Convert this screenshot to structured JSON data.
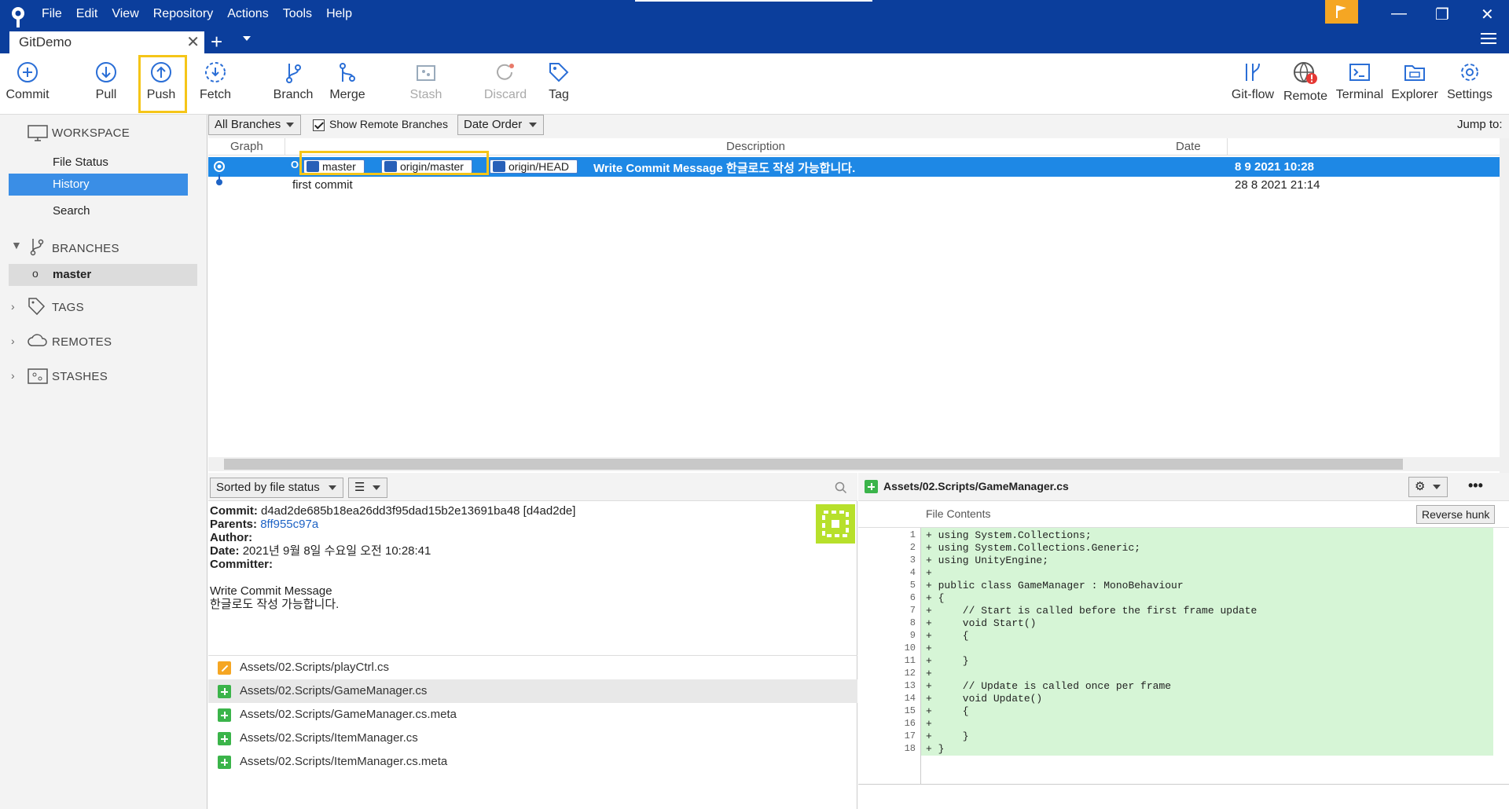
{
  "app": {
    "tab_title": "GitDemo"
  },
  "menu": [
    "File",
    "Edit",
    "View",
    "Repository",
    "Actions",
    "Tools",
    "Help"
  ],
  "toolbar": {
    "commit": "Commit",
    "pull": "Pull",
    "push": "Push",
    "fetch": "Fetch",
    "branch": "Branch",
    "merge": "Merge",
    "stash": "Stash",
    "discard": "Discard",
    "tag": "Tag",
    "gitflow": "Git-flow",
    "remote": "Remote",
    "terminal": "Terminal",
    "explorer": "Explorer",
    "settings": "Settings"
  },
  "sidebar": {
    "workspace": "WORKSPACE",
    "file_status": "File Status",
    "history": "History",
    "search": "Search",
    "branches": "BRANCHES",
    "master": "master",
    "tags": "TAGS",
    "remotes": "REMOTES",
    "stashes": "STASHES"
  },
  "filters": {
    "all_branches": "All Branches",
    "show_remote": "Show Remote Branches",
    "date_order": "Date Order",
    "jump_to": "Jump to:"
  },
  "columns": {
    "graph": "Graph",
    "description": "Description",
    "date": "Date"
  },
  "commits": [
    {
      "labels": [
        "master",
        "origin/master",
        "origin/HEAD"
      ],
      "message": "Write Commit Message 한글로도 작성 가능합니다.",
      "date": "8 9 2021 10:28"
    },
    {
      "message": "first commit",
      "date": "28 8 2021 21:14"
    }
  ],
  "details": {
    "sort_label": "Sorted by file status",
    "commit_key": "Commit:",
    "commit_val": "d4ad2de685b18ea26dd3f95dad15b2e13691ba48 [d4ad2de]",
    "parents_key": "Parents:",
    "parents_val": "8ff955c97a",
    "author_key": "Author:",
    "date_key": "Date:",
    "date_val": "2021년 9월 8일 수요일 오전 10:28:41",
    "committer_key": "Committer:",
    "msg1": "Write Commit Message",
    "msg2": "한글로도 작성 가능합니다."
  },
  "files": [
    {
      "name": "Assets/02.Scripts/playCtrl.cs",
      "status": "modified"
    },
    {
      "name": "Assets/02.Scripts/GameManager.cs",
      "status": "added"
    },
    {
      "name": "Assets/02.Scripts/GameManager.cs.meta",
      "status": "added"
    },
    {
      "name": "Assets/02.Scripts/ItemManager.cs",
      "status": "added"
    },
    {
      "name": "Assets/02.Scripts/ItemManager.cs.meta",
      "status": "added"
    }
  ],
  "diff": {
    "file": "Assets/02.Scripts/GameManager.cs",
    "file_contents": "File Contents",
    "reverse_hunk": "Reverse hunk",
    "lines": [
      "+ using System.Collections;",
      "+ using System.Collections.Generic;",
      "+ using UnityEngine;",
      "+",
      "+ public class GameManager : MonoBehaviour",
      "+ {",
      "+     // Start is called before the first frame update",
      "+     void Start()",
      "+     {",
      "+",
      "+     }",
      "+",
      "+     // Update is called once per frame",
      "+     void Update()",
      "+     {",
      "+",
      "+     }",
      "+ }"
    ]
  },
  "colors": {
    "titlebar": "#0b3e9c",
    "selection": "#1e88e5",
    "highlight": "#f5c518",
    "added": "#3bb44a",
    "modified": "#f5a623"
  }
}
